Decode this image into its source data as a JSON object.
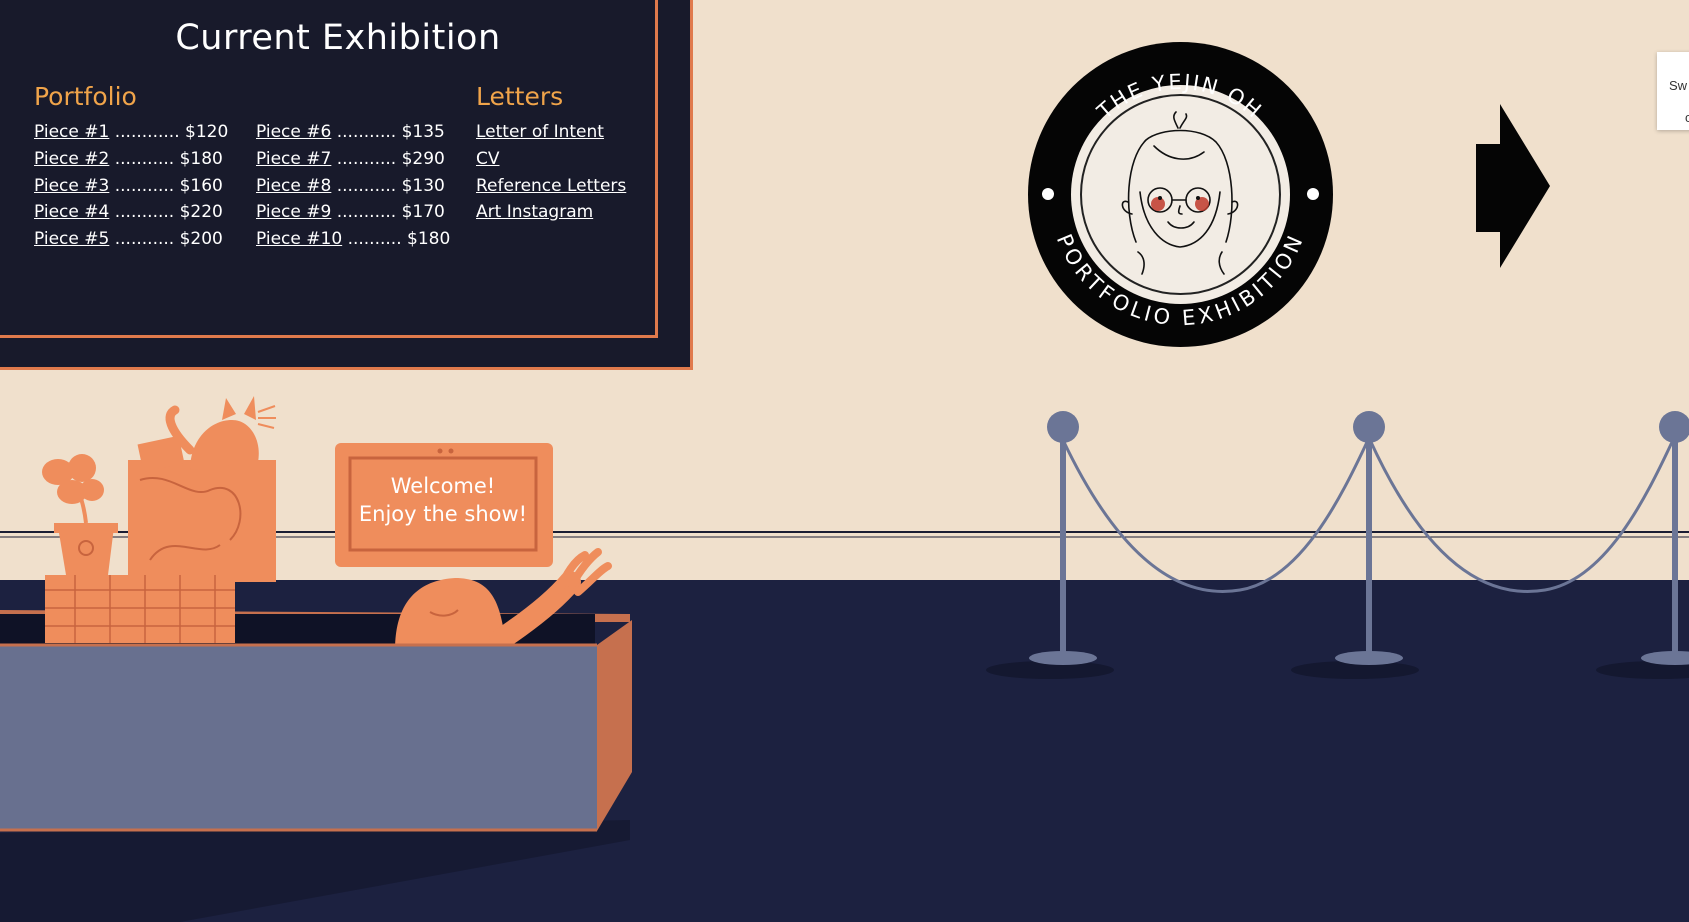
{
  "board": {
    "title": "Current Exhibition",
    "portfolio_heading": "Portfolio",
    "letters_heading": "Letters",
    "pieces_col1": [
      {
        "label": "Piece #1",
        "dots": "............",
        "price": "$120"
      },
      {
        "label": "Piece #2",
        "dots": "...........",
        "price": "$180"
      },
      {
        "label": "Piece #3",
        "dots": "...........",
        "price": "$160"
      },
      {
        "label": "Piece #4",
        "dots": "...........",
        "price": "$220"
      },
      {
        "label": "Piece #5",
        "dots": "...........",
        "price": "$200"
      }
    ],
    "pieces_col2": [
      {
        "label": "Piece #6",
        "dots": "...........",
        "price": "$135"
      },
      {
        "label": "Piece #7",
        "dots": "...........",
        "price": "$290"
      },
      {
        "label": "Piece #8",
        "dots": "...........",
        "price": "$130"
      },
      {
        "label": "Piece #9",
        "dots": "...........",
        "price": "$170"
      },
      {
        "label": "Piece #10",
        "dots": "..........",
        "price": "$180"
      }
    ],
    "letters": [
      "Letter of Intent",
      "CV",
      "Reference Letters",
      "Art Instagram"
    ]
  },
  "emblem": {
    "top_text": "THE YEJIN OH",
    "bottom_text": "PORTFOLIO EXHIBITION"
  },
  "welcome_sign": {
    "line1": "Welcome!",
    "line2": "Enjoy the show!"
  },
  "tooltip": {
    "line1": "Sw",
    "line2": "c"
  },
  "icons": {
    "next": "arrow-right-icon"
  },
  "colors": {
    "wall": "#f0e0cc",
    "floor": "#1c2140",
    "board": "#181a2b",
    "accent_orange": "#e07a4c",
    "heading_orange": "#f0a44a",
    "stanchion": "#6b7596",
    "desk_front": "#68708f"
  }
}
